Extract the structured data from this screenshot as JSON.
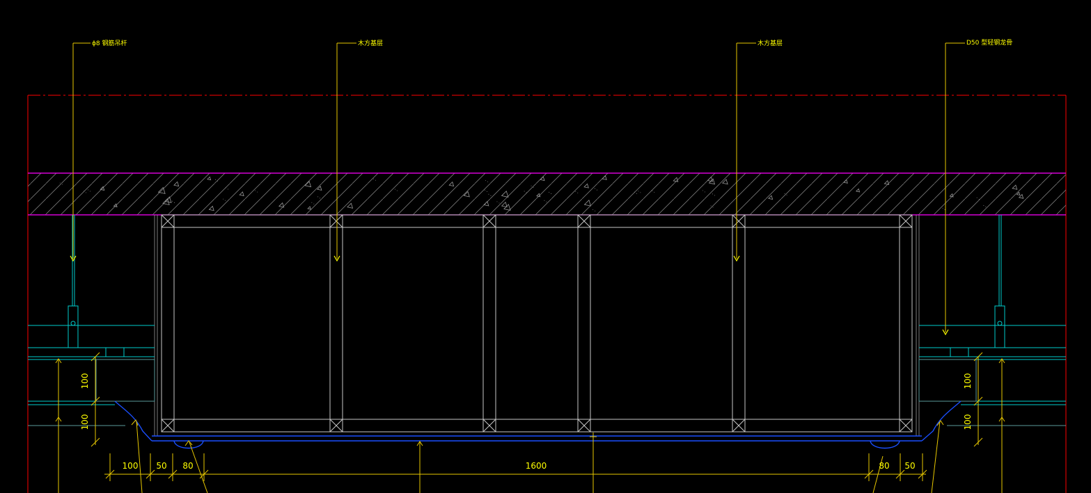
{
  "drawing": {
    "callouts": {
      "rod": "ϕ8 钢筋吊杆",
      "wood_left": "木方基层",
      "wood_right": "木方基层",
      "keel": "D50 型轻钢龙骨"
    },
    "dimensions": {
      "h100_left_upper": "100",
      "h100_left_lower": "100",
      "h100_right_upper": "100",
      "h100_right_lower": "100",
      "w100": "100",
      "w50_left": "50",
      "w80_left": "80",
      "w1600": "1600",
      "w80_right": "80",
      "w50_right": "50"
    },
    "colors": {
      "background": "#000000",
      "boundary": "#ff0000",
      "slab_edge": "#ff00ff",
      "slab_hatch": "#8a8a8a",
      "frame": "#c8c8c8",
      "ceiling": "#00cccc",
      "leader": "#ffff00",
      "dimension": "#ffcc00",
      "finish": "#1a4fff"
    }
  }
}
